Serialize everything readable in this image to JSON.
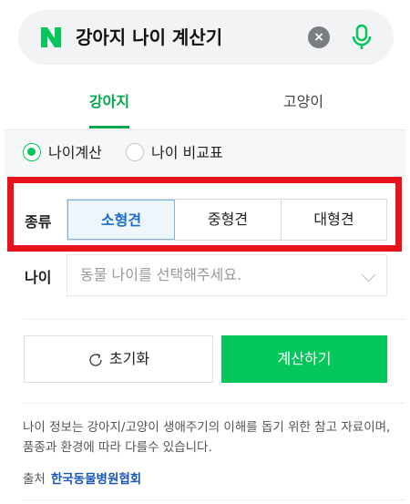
{
  "search": {
    "query": "강아지 나이 계산기",
    "logo_letter": "N",
    "icons": [
      "naver-logo-icon",
      "clear-icon",
      "mic-icon"
    ],
    "brand_color": "#03c75a"
  },
  "tabs": [
    {
      "label": "강아지",
      "selected": true
    },
    {
      "label": "고양이",
      "selected": false
    }
  ],
  "mode": {
    "options": [
      {
        "label": "나이계산",
        "checked": true
      },
      {
        "label": "나이 비교표",
        "checked": false
      }
    ]
  },
  "kind": {
    "label": "종류",
    "options": [
      "소형견",
      "중형견",
      "대형견"
    ],
    "selected": "소형견"
  },
  "age": {
    "label": "나이",
    "placeholder": "동물 나이를 선택해주세요."
  },
  "actions": {
    "reset_label": "초기화",
    "calc_label": "계산하기"
  },
  "info": {
    "note": "나이 정보는 강아지/고양이 생애주기의 이해를 돕기 위한 참고 자료이며, 품종과 환경에 따라 다를수 있습니다.",
    "source_label": "출처",
    "source_link": "한국동물병원협회"
  },
  "highlight_color": "#e8121b"
}
